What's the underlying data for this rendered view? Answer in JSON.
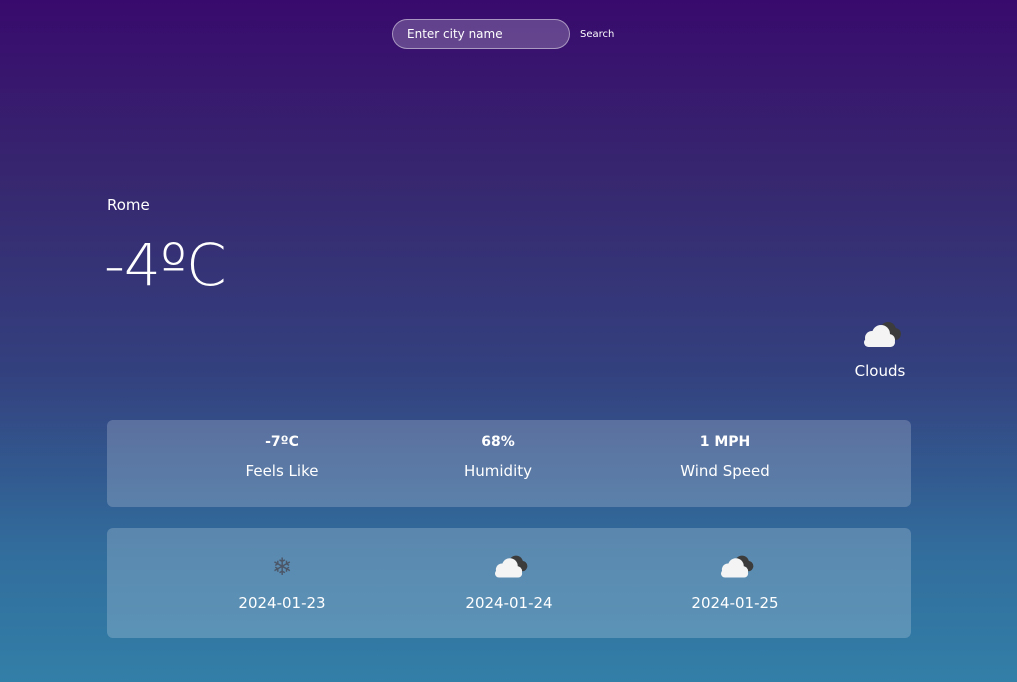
{
  "search": {
    "placeholder": "Enter city name",
    "button_label": "Search"
  },
  "current": {
    "city": "Rome",
    "temperature": "-4ºC",
    "condition": "Clouds",
    "condition_icon": "clouds-icon"
  },
  "details": [
    {
      "value": "-7ºC",
      "label": "Feels Like"
    },
    {
      "value": "68%",
      "label": "Humidity"
    },
    {
      "value": "1 MPH",
      "label": "Wind Speed"
    }
  ],
  "forecast": [
    {
      "date": "2024-01-23",
      "icon": "snow-icon"
    },
    {
      "date": "2024-01-24",
      "icon": "clouds-icon"
    },
    {
      "date": "2024-01-25",
      "icon": "clouds-icon"
    }
  ],
  "colors": {
    "gradient_top": "#380a6d",
    "gradient_bottom": "#327fa8",
    "cloud_light": "#f4f4f4",
    "cloud_dark": "#3c3c3c",
    "snow": "#4b5566"
  }
}
